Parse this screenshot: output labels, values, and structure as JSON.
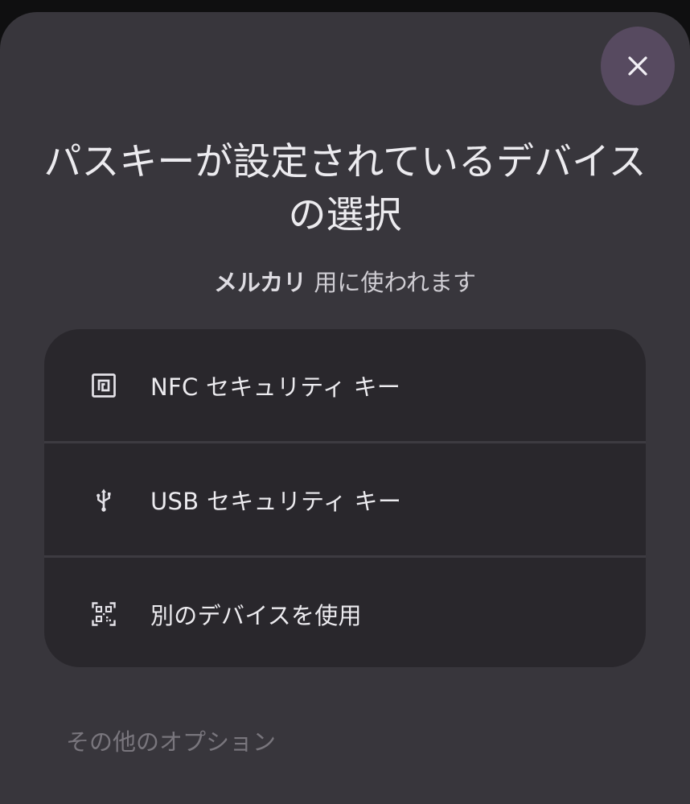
{
  "dialog": {
    "title": "パスキーが設定されているデバイスの選択",
    "subtitle_app": "メルカリ",
    "subtitle_suffix": " 用に使われます",
    "close_icon": "close-icon"
  },
  "options": [
    {
      "label": "NFC セキュリティ キー",
      "icon": "nfc-icon"
    },
    {
      "label": "USB セキュリティ キー",
      "icon": "usb-icon"
    },
    {
      "label": "別のデバイスを使用",
      "icon": "qr-code-icon"
    }
  ],
  "footer": {
    "more_options": "その他のオプション"
  },
  "colors": {
    "sheet_bg": "#38363c",
    "card_bg": "#29272c",
    "close_bg": "#574a60",
    "text_primary": "#ecebef",
    "text_muted": "#79767d"
  }
}
